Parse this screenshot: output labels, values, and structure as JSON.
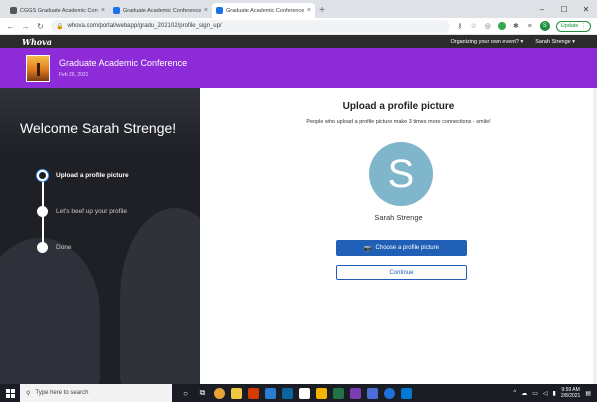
{
  "browser": {
    "tabs": [
      {
        "title": "CGGS Graduate Academic Conf...",
        "color": "#555555",
        "active": false
      },
      {
        "title": "Graduate Academic Conference",
        "color": "#1a73e8",
        "active": false
      },
      {
        "title": "Graduate Academic Conference",
        "color": "#1a73e8",
        "active": true
      }
    ],
    "tab_close": "×",
    "new_tab": "+",
    "window_controls": [
      "–",
      "☐",
      "✕"
    ],
    "url": "whova.com/portal/webapp/gradu_202102/profile_sign_up/",
    "update_label": "Update",
    "profile_initial": "S"
  },
  "whova": {
    "logo": "Whova",
    "organizing_link": "Organizing your own event? ▾",
    "user_menu": "Sarah Strenge ▾"
  },
  "event": {
    "title": "Graduate Academic Conference",
    "date": "Feb 26, 2021"
  },
  "left": {
    "welcome": "Welcome Sarah Strenge!",
    "steps": [
      {
        "label": "Upload a profile picture",
        "active": true
      },
      {
        "label": "Let's beef up your profile",
        "active": false
      },
      {
        "label": "Done",
        "active": false
      }
    ]
  },
  "main": {
    "title": "Upload a profile picture",
    "subtitle": "People who upload a profile picture make 3 times more connections - smile!",
    "avatar_initial": "S",
    "name": "Sarah Strenge",
    "choose_button": "Choose a profile picture",
    "continue_button": "Continue",
    "accent_color": "#1f5fb6"
  },
  "taskbar": {
    "search_placeholder": "Type here to search",
    "time": "9:59 AM",
    "date": "2/8/2021"
  }
}
